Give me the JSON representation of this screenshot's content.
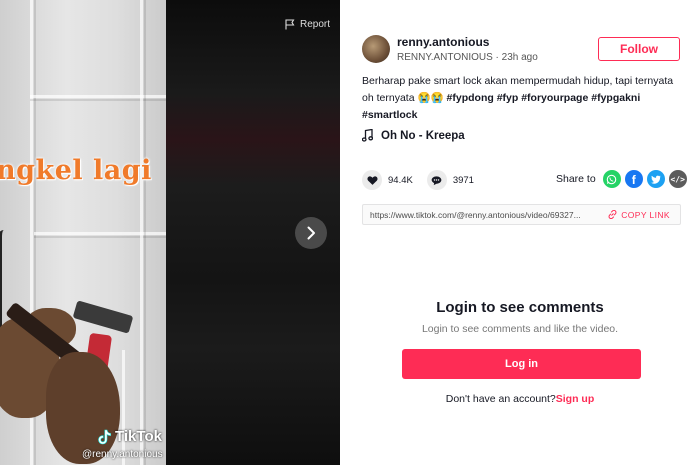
{
  "video": {
    "overlay_text": "ngkel lagi",
    "watermark_brand": "TikTok",
    "watermark_handle": "@renny.antonious",
    "report_label": "Report",
    "next_icon": "chevron-right-icon"
  },
  "author": {
    "username": "renny.antonious",
    "nickname": "RENNY.ANTONIOUS",
    "separator": " · ",
    "posted": "23h ago",
    "follow_label": "Follow"
  },
  "caption": {
    "text": "Berharap pake smart lock akan mempermudah hidup, tapi ternyata oh ternyata 😭😭 ",
    "hashtags": [
      "#fypdong",
      "#fyp",
      "#foryourpage",
      "#fypgakni",
      "#smartlock"
    ]
  },
  "music": {
    "title": "Oh No - Kreepa"
  },
  "stats": {
    "likes": "94.4K",
    "comments": "3971"
  },
  "share": {
    "label": "Share to",
    "targets": [
      {
        "name": "whatsapp",
        "color": "#25d366",
        "glyph": "✆"
      },
      {
        "name": "facebook",
        "color": "#1877f2",
        "glyph": "f"
      },
      {
        "name": "twitter",
        "color": "#1da1f2",
        "glyph": "t"
      },
      {
        "name": "embed",
        "color": "#5c5c5c",
        "glyph": "‹›"
      }
    ]
  },
  "link": {
    "url": "https://www.tiktok.com/@renny.antonious/video/69327...",
    "copy_label": "COPY LINK"
  },
  "comments_login": {
    "title": "Login to see comments",
    "subtitle": "Login to see comments and like the video.",
    "button_label": "Log in",
    "no_account_text": "Don't have an account?",
    "signup_label": "Sign up"
  },
  "colors": {
    "brand": "#fe2c55",
    "text": "#161823",
    "overlay": "#f07a2a"
  }
}
